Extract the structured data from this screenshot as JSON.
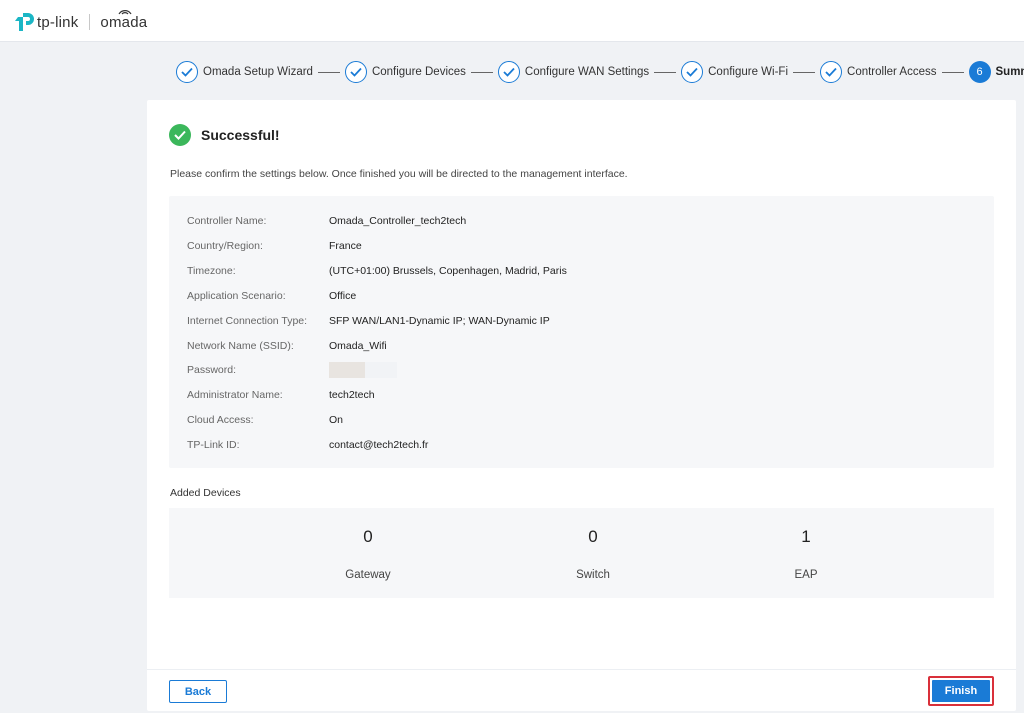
{
  "header": {
    "brand_tp": "tp-link",
    "brand_omada": "omada",
    "accent": "#1a7bd6"
  },
  "wizard": {
    "steps": [
      {
        "label": "Omada Setup Wizard",
        "status": "done"
      },
      {
        "label": "Configure Devices",
        "status": "done"
      },
      {
        "label": "Configure WAN Settings",
        "status": "done"
      },
      {
        "label": "Configure Wi-Fi",
        "status": "done"
      },
      {
        "label": "Controller Access",
        "status": "done"
      },
      {
        "label": "Summary",
        "status": "active",
        "number": "6"
      }
    ]
  },
  "main": {
    "success_title": "Successful!",
    "confirm_text": "Please confirm the settings below. Once finished you will be directed to the management interface.",
    "summary": [
      {
        "label": "Controller Name:",
        "value": "Omada_Controller_tech2tech"
      },
      {
        "label": "Country/Region:",
        "value": "France"
      },
      {
        "label": "Timezone:",
        "value": "(UTC+01:00) Brussels, Copenhagen, Madrid, Paris"
      },
      {
        "label": "Application Scenario:",
        "value": "Office"
      },
      {
        "label": "Internet Connection Type:",
        "value": "SFP WAN/LAN1-Dynamic IP; WAN-Dynamic IP"
      },
      {
        "label": "Network Name (SSID):",
        "value": "Omada_Wifi"
      },
      {
        "label": "Password:",
        "value": ""
      },
      {
        "label": "Administrator Name:",
        "value": "tech2tech"
      },
      {
        "label": "Cloud Access:",
        "value": "On"
      },
      {
        "label": "TP-Link ID:",
        "value": "contact@tech2tech.fr"
      }
    ],
    "added_devices_label": "Added Devices",
    "devices": [
      {
        "count": "0",
        "name": "Gateway"
      },
      {
        "count": "0",
        "name": "Switch"
      },
      {
        "count": "1",
        "name": "EAP"
      }
    ]
  },
  "footer": {
    "back_label": "Back",
    "finish_label": "Finish"
  }
}
